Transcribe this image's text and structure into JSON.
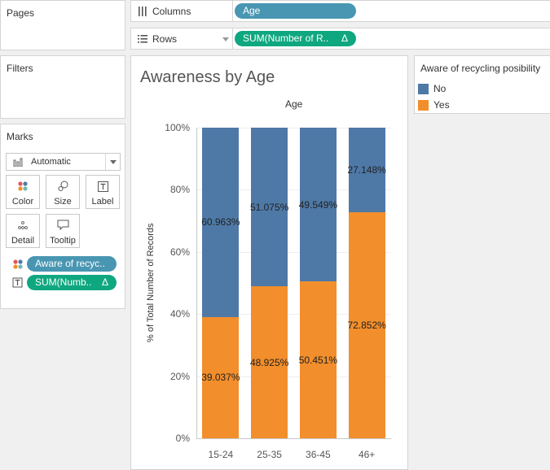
{
  "panels": {
    "pages_title": "Pages",
    "filters_title": "Filters",
    "marks_title": "Marks"
  },
  "marks": {
    "mark_type": "Automatic",
    "buttons": [
      "Color",
      "Size",
      "Label",
      "Detail",
      "Tooltip"
    ],
    "fields": [
      {
        "label": "Aware of recyc..",
        "type": "color"
      },
      {
        "label": "SUM(Numb..",
        "type": "label",
        "delta": "Δ"
      }
    ]
  },
  "shelves": {
    "columns_label": "Columns",
    "columns_pill": "Age",
    "rows_label": "Rows",
    "rows_pill": "SUM(Number of R..",
    "rows_delta": "Δ"
  },
  "worksheet": {
    "title": "Awareness by Age"
  },
  "legend": {
    "title": "Aware of recycling posibility",
    "items": [
      {
        "label": "No",
        "color": "#4e79a7"
      },
      {
        "label": "Yes",
        "color": "#f28e2b"
      }
    ]
  },
  "chart_data": {
    "type": "bar",
    "stacked": true,
    "title": "Awareness by Age",
    "xlabel": "Age",
    "ylabel": "% of Total Number of Records",
    "categories": [
      "15-24",
      "25-35",
      "36-45",
      "46+"
    ],
    "series": [
      {
        "name": "Yes",
        "color": "#f28e2b",
        "values": [
          39.037,
          48.925,
          50.451,
          72.852
        ],
        "labels": [
          "39.037%",
          "48.925%",
          "50.451%",
          "72.852%"
        ]
      },
      {
        "name": "No",
        "color": "#4e79a7",
        "values": [
          60.963,
          51.075,
          49.549,
          27.148
        ],
        "labels": [
          "60.963%",
          "51.075%",
          "49.549%",
          "27.148%"
        ]
      }
    ],
    "ylim": [
      0,
      100
    ],
    "yticks": [
      "0%",
      "20%",
      "40%",
      "60%",
      "80%",
      "100%"
    ],
    "grid": true
  }
}
